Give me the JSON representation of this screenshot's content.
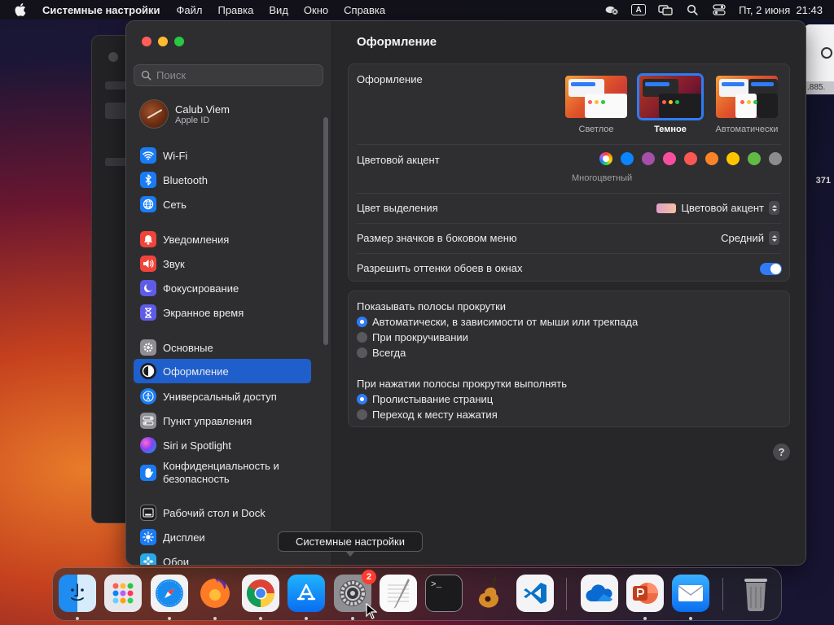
{
  "menubar": {
    "app_name": "Системные настройки",
    "menus": [
      "Файл",
      "Правка",
      "Вид",
      "Окно",
      "Справка"
    ],
    "input_indicator": "A",
    "clock": "Пт, 2 июня  21:43"
  },
  "background_fragments": {
    "number_a": ".885.",
    "number_b": "371"
  },
  "sidebar": {
    "search_placeholder": "Поиск",
    "account": {
      "name": "Calub Viem",
      "subtitle": "Apple ID"
    },
    "items": [
      {
        "label": "Wi-Fi",
        "icon": "wifi-icon",
        "color": "#1a7cf5"
      },
      {
        "label": "Bluetooth",
        "icon": "bluetooth-icon",
        "color": "#1a7cf5"
      },
      {
        "label": "Сеть",
        "icon": "globe-icon",
        "color": "#1a7cf5"
      },
      {
        "label": "Уведомления",
        "icon": "bell-icon",
        "color": "#f0443a"
      },
      {
        "label": "Звук",
        "icon": "speaker-icon",
        "color": "#f0443a"
      },
      {
        "label": "Фокусирование",
        "icon": "moon-icon",
        "color": "#5e5ce6"
      },
      {
        "label": "Экранное время",
        "icon": "hourglass-icon",
        "color": "#5e5ce6"
      },
      {
        "label": "Основные",
        "icon": "gear-icon",
        "color": "#8e8e93"
      },
      {
        "label": "Оформление",
        "icon": "appearance-icon",
        "color": "#1c1c1e"
      },
      {
        "label": "Универсальный доступ",
        "icon": "accessibility-icon",
        "color": "#1a7cf5"
      },
      {
        "label": "Пункт управления",
        "icon": "control-center-icon",
        "color": "#8e8e93"
      },
      {
        "label": "Siri и Spotlight",
        "icon": "siri-icon",
        "color": "#8a3ff0"
      },
      {
        "label": "Конфиденциальность и безопасность",
        "icon": "hand-icon",
        "color": "#1a7cf5"
      },
      {
        "label": "Рабочий стол и Dock",
        "icon": "dock-icon",
        "color": "#1c1c1e"
      },
      {
        "label": "Дисплеи",
        "icon": "sun-icon",
        "color": "#1a7cf5"
      },
      {
        "label": "Обои",
        "icon": "flower-icon",
        "color": "#2aa8e8"
      }
    ],
    "active_item": "Оформление"
  },
  "content": {
    "title": "Оформление",
    "appearance": {
      "label": "Оформление",
      "options": [
        "Светлое",
        "Темное",
        "Автоматически"
      ],
      "selected": "Темное"
    },
    "accent": {
      "label": "Цветовой акцент",
      "caption": "Многоцветный",
      "colors": [
        "multicolor",
        "#0a84ff",
        "#a550a7",
        "#f74f9e",
        "#fc5753",
        "#fd8328",
        "#ffc600",
        "#62ba46",
        "#8c8c8c"
      ]
    },
    "highlight": {
      "label": "Цвет выделения",
      "value": "Цветовой акцент"
    },
    "sidebar_icon_size": {
      "label": "Размер значков в боковом меню",
      "value": "Средний"
    },
    "wallpaper_tinting": {
      "label": "Разрешить оттенки обоев в окнах",
      "enabled": true
    },
    "scrollbars": {
      "label": "Показывать полосы прокрутки",
      "options": [
        "Автоматически, в зависимости от мыши или трекпада",
        "При прокручивании",
        "Всегда"
      ],
      "selected": 0
    },
    "click_scrollbar": {
      "label": "При нажатии полосы прокрутки выполнять",
      "options": [
        "Пролистывание страниц",
        "Переход к месту нажатия"
      ],
      "selected": 0
    },
    "help": "?"
  },
  "tooltip": "Системные настройки",
  "dock": {
    "apps": [
      {
        "name": "Finder",
        "icon": "finder-icon",
        "running": true
      },
      {
        "name": "Launchpad",
        "icon": "launchpad-icon",
        "running": false
      },
      {
        "name": "Safari",
        "icon": "safari-icon",
        "running": true
      },
      {
        "name": "Firefox",
        "icon": "firefox-icon",
        "running": true
      },
      {
        "name": "Chrome",
        "icon": "chrome-icon",
        "running": true
      },
      {
        "name": "App Store",
        "icon": "app-store-icon",
        "running": true
      },
      {
        "name": "Системные настройки",
        "icon": "system-settings-icon",
        "running": true,
        "badge": "2"
      },
      {
        "name": "TextEdit",
        "icon": "textedit-icon",
        "running": false
      },
      {
        "name": "Terminal",
        "icon": "terminal-icon",
        "running": false
      },
      {
        "name": "GarageBand",
        "icon": "garageband-icon",
        "running": false
      },
      {
        "name": "Visual Studio Code",
        "icon": "vscode-icon",
        "running": false
      },
      {
        "name": "OneDrive",
        "icon": "onedrive-icon",
        "running": false
      },
      {
        "name": "PowerPoint",
        "icon": "powerpoint-icon",
        "running": true
      },
      {
        "name": "Mail",
        "icon": "mail-icon",
        "running": true
      },
      {
        "name": "Корзина",
        "icon": "trash-icon",
        "running": false
      }
    ]
  }
}
